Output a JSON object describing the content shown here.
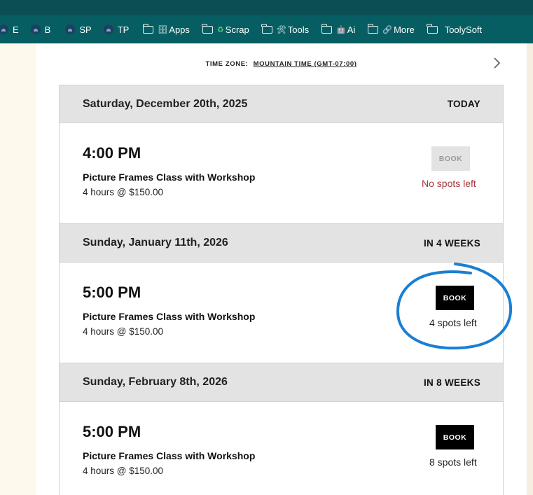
{
  "bookmarks": [
    {
      "kind": "profile",
      "label": "E",
      "icon": "profile-circle-icon"
    },
    {
      "kind": "profile",
      "label": "B",
      "icon": "profile-circle-icon"
    },
    {
      "kind": "profile",
      "label": "SP",
      "icon": "profile-circle-icon"
    },
    {
      "kind": "profile",
      "label": "TP",
      "icon": "profile-circle-icon"
    },
    {
      "kind": "folder",
      "label": "Apps",
      "emoji": "🗄",
      "icon": "folder-icon"
    },
    {
      "kind": "folder",
      "label": "Scrap",
      "emoji": "♻",
      "icon": "folder-icon"
    },
    {
      "kind": "folder",
      "label": "Tools",
      "emoji": "🛠",
      "icon": "folder-icon"
    },
    {
      "kind": "folder",
      "label": "Ai",
      "emoji": "🤖",
      "icon": "folder-icon"
    },
    {
      "kind": "folder",
      "label": "More",
      "emoji": "🔗",
      "icon": "folder-icon"
    },
    {
      "kind": "folder",
      "label": "ToolySoft",
      "emoji": "",
      "icon": "folder-icon"
    }
  ],
  "timezone": {
    "label": "TIME ZONE:",
    "value": "MOUNTAIN TIME (GMT-07:00)"
  },
  "days": [
    {
      "date": "Saturday, December 20th, 2025",
      "relative": "TODAY",
      "slot": {
        "time": "4:00 PM",
        "title": "Picture Frames Class with Workshop",
        "meta": "4 hours @ $150.00",
        "button": "BOOK",
        "available": false,
        "spots": "No spots left"
      }
    },
    {
      "date": "Sunday, January 11th, 2026",
      "relative": "IN 4 WEEKS",
      "slot": {
        "time": "5:00 PM",
        "title": "Picture Frames Class with Workshop",
        "meta": "4 hours @ $150.00",
        "button": "BOOK",
        "available": true,
        "spots": "4 spots left"
      }
    },
    {
      "date": "Sunday, February 8th, 2026",
      "relative": "IN 8 WEEKS",
      "slot": {
        "time": "5:00 PM",
        "title": "Picture Frames Class with Workshop",
        "meta": "4 hours @ $150.00",
        "button": "BOOK",
        "available": true,
        "spots": "8 spots left"
      }
    }
  ],
  "colors": {
    "bookmark_bar": "#075e62",
    "top_strip": "#0c4f52",
    "page_background": "#fdf9ed",
    "day_header": "#e3e3e3",
    "sold_out": "#a4363b",
    "book_button": "#000000",
    "annotation": "#1a7fd4"
  }
}
